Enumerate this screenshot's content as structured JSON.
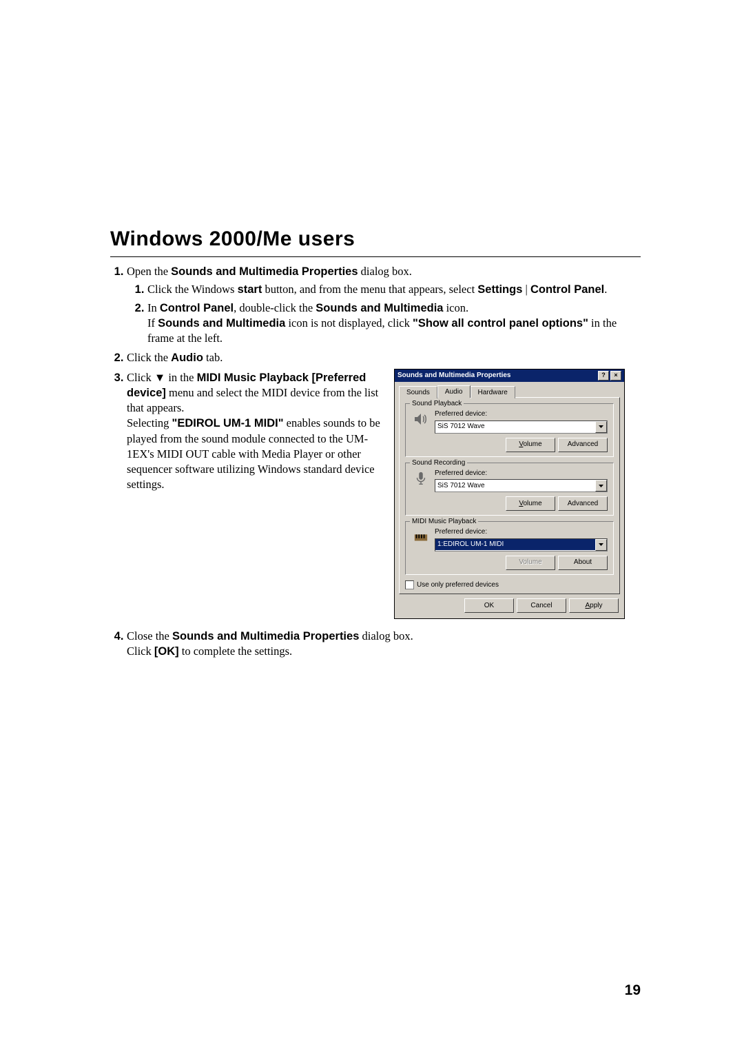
{
  "heading": "Windows 2000/Me users",
  "step1": {
    "t1": "Open the ",
    "b1": "Sounds and Multimedia Properties",
    "t2": " dialog box.",
    "s1": {
      "t1": "Click the Windows ",
      "b1": "start",
      "t2": " button, and from the menu that appears, select ",
      "b2": "Settings",
      "t3": " | ",
      "b3": "Control Panel",
      "t4": "."
    },
    "s2": {
      "t1": "In ",
      "b1": "Control Panel",
      "t2": ", double-click the ",
      "b2": "Sounds and Multimedia",
      "t3": " icon.",
      "t4": "If ",
      "b3": "Sounds and Multimedia",
      "t5": " icon is not displayed, click ",
      "b4": "\"Show all control panel options\"",
      "t6": " in the frame at the left."
    }
  },
  "step2": {
    "t1": "Click the ",
    "b1": "Audio",
    "t2": " tab."
  },
  "step3": {
    "t1": "Click ▼ in the ",
    "b1": "MIDI Music Playback [Preferred device]",
    "t2": " menu and select the MIDI device from the list that appears.",
    "t3": "Selecting ",
    "b2": "\"EDIROL UM-1 MIDI\"",
    "t4": " enables sounds to be played from the sound module connected to the UM-1EX's MIDI OUT cable with Media Player or other sequencer software utilizing Windows standard device settings."
  },
  "step4": {
    "t1": "Close the ",
    "b1": "Sounds and Multimedia Properties",
    "t2": " dialog box.",
    "t3": "Click ",
    "b2": "[OK]",
    "t4": " to complete the settings."
  },
  "dialog": {
    "title": "Sounds and Multimedia Properties",
    "tabs": {
      "sounds": "Sounds",
      "audio": "Audio",
      "hardware": "Hardware"
    },
    "playback": {
      "legend": "Sound Playback",
      "label": "Preferred device:",
      "value": "SiS 7012 Wave"
    },
    "recording": {
      "legend": "Sound Recording",
      "label": "Preferred device:",
      "value": "SiS 7012 Wave"
    },
    "midi": {
      "legend": "MIDI Music Playback",
      "label": "Preferred device:",
      "value": "1:EDIROL UM-1 MIDI"
    },
    "volume": "Volume",
    "advanced": "Advanced",
    "about": "About",
    "useonly": "Use only preferred devices",
    "ok": "OK",
    "cancel": "Cancel",
    "apply": "Apply"
  },
  "pagenum": "19"
}
